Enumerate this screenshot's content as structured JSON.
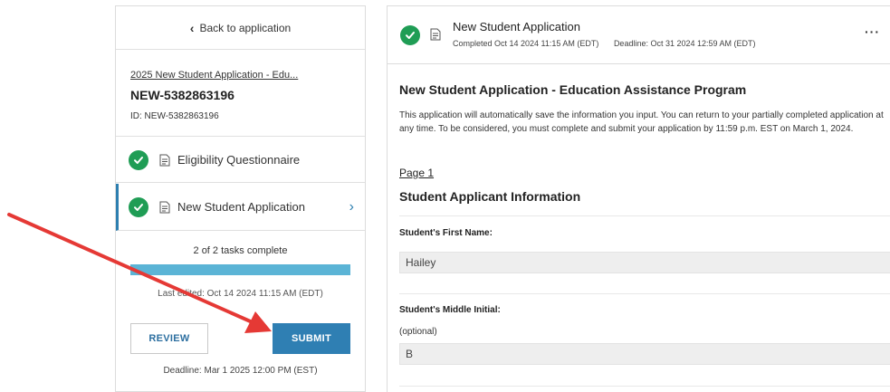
{
  "sidebar": {
    "back_label": "Back to application",
    "application_link": "2025 New Student Application - Edu...",
    "application_number": "NEW-5382863196",
    "application_id": "ID: NEW-5382863196",
    "tasks": [
      {
        "label": "Eligibility Questionnaire",
        "status": "complete",
        "selected": false
      },
      {
        "label": "New Student Application",
        "status": "complete",
        "selected": true
      }
    ],
    "progress_text": "2 of 2 tasks complete",
    "progress_fraction": 1.0,
    "last_edited": "Last edited: Oct 14 2024 11:15 AM (EDT)",
    "review_label": "REVIEW",
    "submit_label": "SUBMIT",
    "deadline": "Deadline: Mar 1 2025 12:00 PM (EST)"
  },
  "main": {
    "header_title": "New Student Application",
    "completed": "Completed Oct 14 2024 11:15 AM (EDT)",
    "deadline": "Deadline: Oct 31 2024 12:59 AM (EDT)",
    "more_label": "···",
    "form_title": "New Student Application - Education Assistance Program",
    "intro_text": "This application will automatically save the information you input. You can return to your partially completed application at any time. To be considered, you must complete and submit your application by 11:59 p.m. EST on March 1, 2024.",
    "page_label": "Page 1",
    "section_title": "Student Applicant Information",
    "fields": [
      {
        "label": "Student's First Name:",
        "hint": "",
        "value": "Hailey"
      },
      {
        "label": "Student's Middle Initial:",
        "hint": "(optional)",
        "value": "B"
      }
    ]
  },
  "colors": {
    "accent": "#2f7fb3",
    "success": "#1f9d55",
    "progress": "#5bb4d6",
    "annotation_arrow": "#e53935"
  }
}
